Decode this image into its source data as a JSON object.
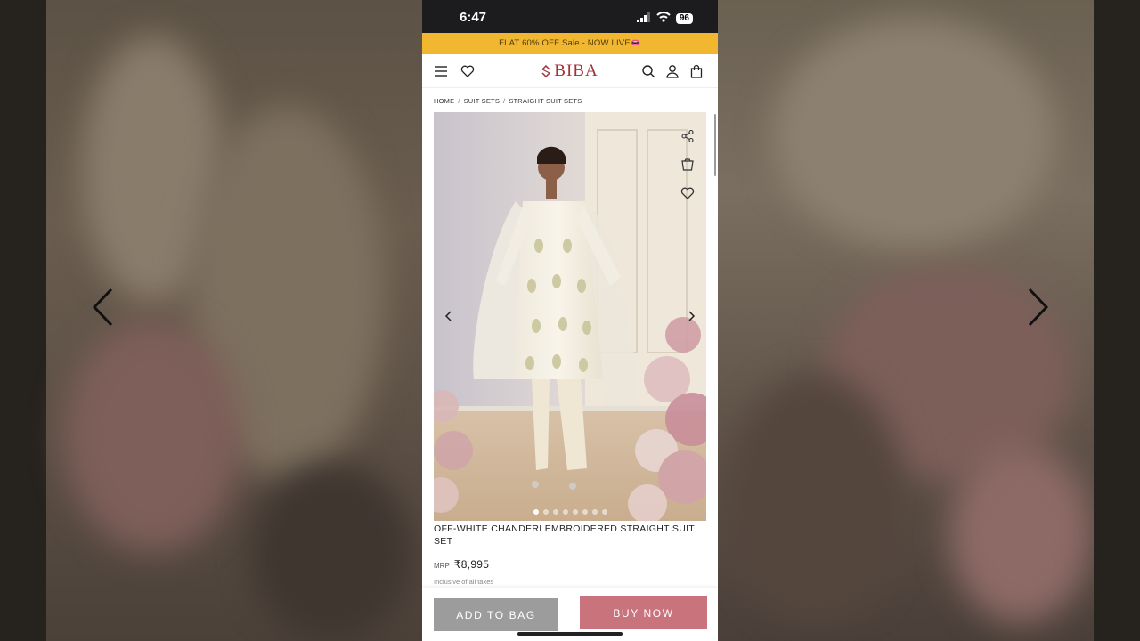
{
  "status": {
    "time": "6:47",
    "battery": "96"
  },
  "promo": {
    "text": "FLAT 60% OFF Sale - NOW LIVE👄"
  },
  "header": {
    "brand": "BIBA",
    "brand_color": "#a2323a"
  },
  "breadcrumb": {
    "home": "HOME",
    "level1": "SUIT SETS",
    "level2": "STRAIGHT SUIT SETS",
    "sep": "/"
  },
  "product": {
    "title": "OFF-WHITE CHANDERI EMBROIDERED STRAIGHT SUIT SET",
    "mrp_label": "MRP",
    "price": "₹8,995",
    "tax_note": "Inclusive of all taxes"
  },
  "actions": {
    "add_to_bag": "ADD TO BAG",
    "buy_now": "BUY NOW"
  },
  "colors": {
    "promo_bg": "#f2b730",
    "buy_now_bg": "#c9747c",
    "add_to_bag_bg": "#9c9c9c"
  },
  "icons": [
    "menu-icon",
    "heart-icon",
    "search-icon",
    "user-icon",
    "bag-icon",
    "share-icon",
    "wardrobe-icon",
    "wishlist-icon",
    "chevron-left-icon",
    "chevron-right-icon"
  ]
}
